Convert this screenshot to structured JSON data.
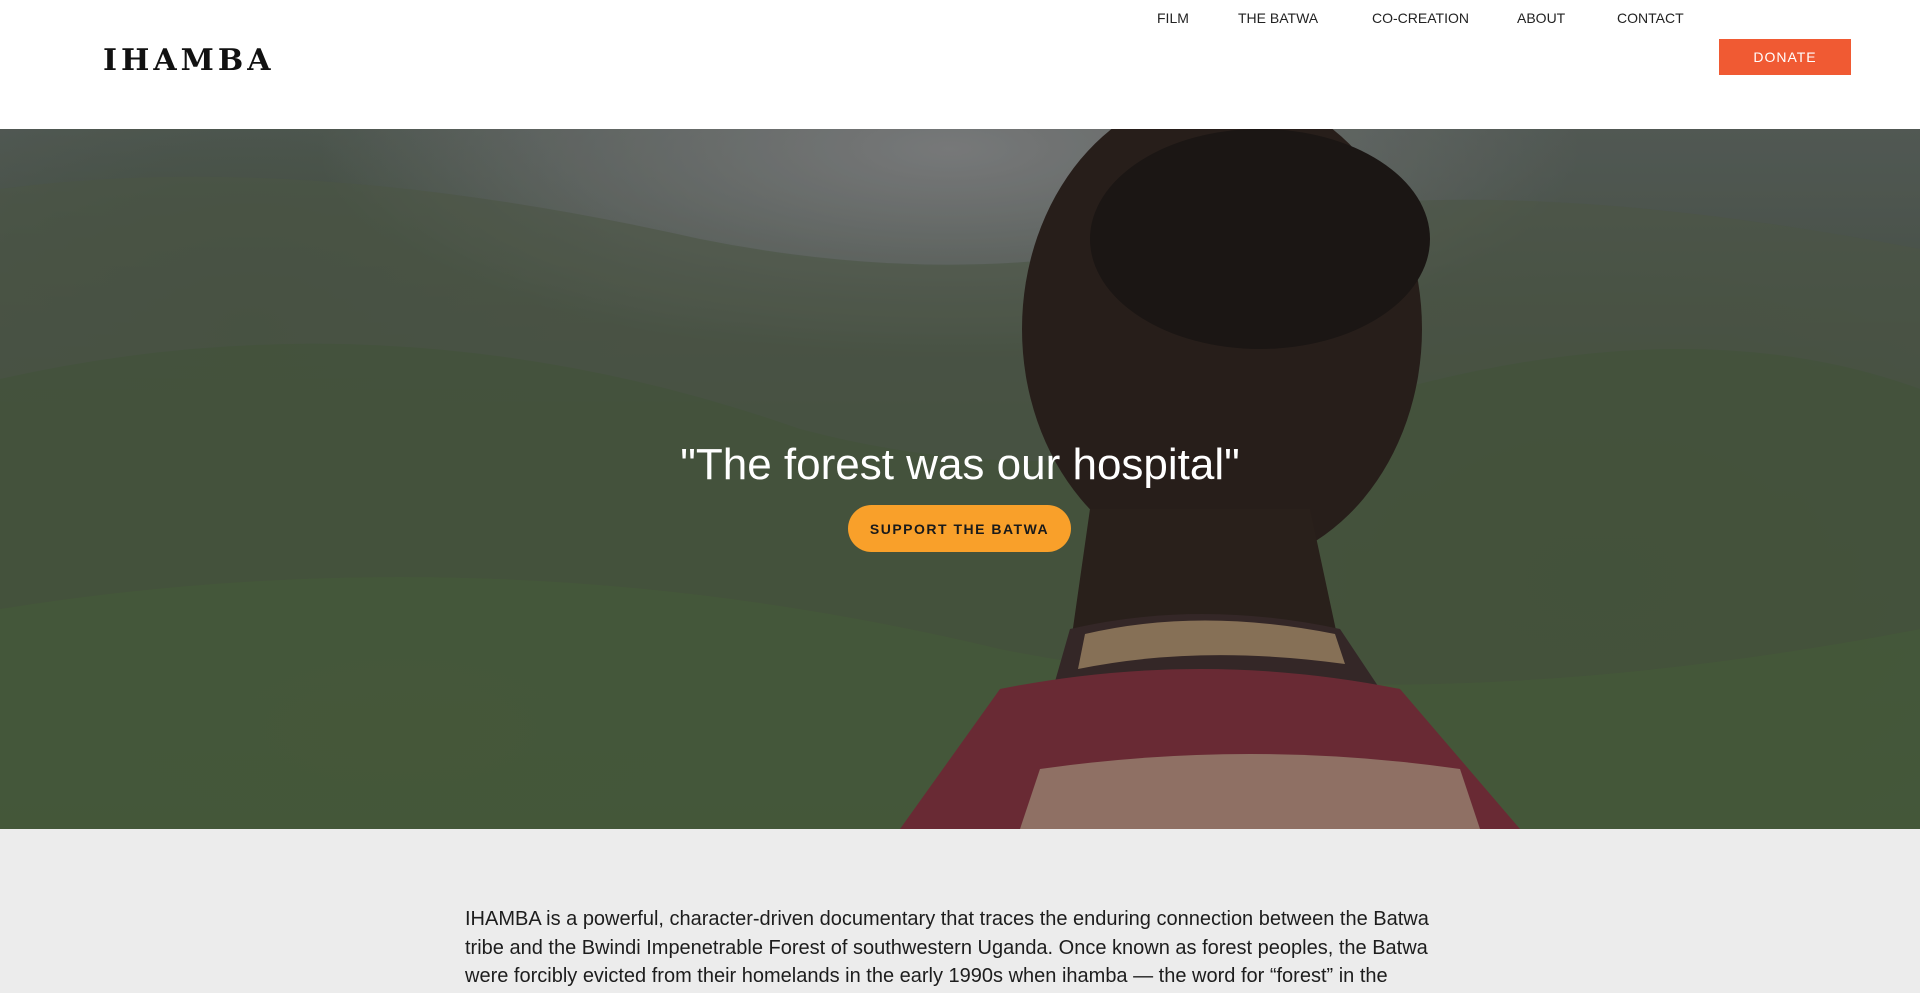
{
  "header": {
    "logo": "IHAMBA",
    "nav": [
      "FILM",
      "THE BATWA",
      "CO-CREATION",
      "ABOUT",
      "CONTACT"
    ],
    "donate_label": "DONATE"
  },
  "hero": {
    "quote": "\"The forest was our hospital\"",
    "cta_label": "SUPPORT THE BATWA",
    "cta_color": "#f9a02a"
  },
  "intro": {
    "text": "IHAMBA is a powerful, character-driven documentary that traces the enduring connection between the Batwa tribe and the Bwindi Impenetrable Forest of southwestern Uganda. Once known as forest peoples, the Batwa were forcibly evicted from their homelands in the early 1990s when ihamba — the word for “forest” in the"
  },
  "colors": {
    "accent": "#f05a33",
    "intro_bg": "#ececec"
  }
}
